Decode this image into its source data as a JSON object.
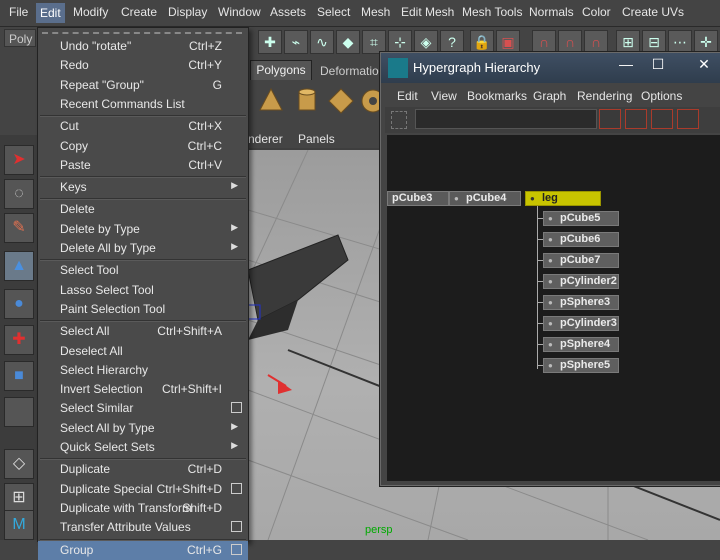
{
  "menubar": {
    "items": [
      "File",
      "Edit",
      "Modify",
      "Create",
      "Display",
      "Window",
      "Assets",
      "Select",
      "Mesh",
      "Edit Mesh",
      "Mesh Tools",
      "Normals",
      "Color",
      "Create UVs"
    ],
    "active": "Edit"
  },
  "mode_selector": "Poly",
  "shelf": {
    "tabs": [
      "Polygons",
      "Deformatio"
    ]
  },
  "viewport": {
    "menu": [
      "nderer",
      "Panels"
    ],
    "camera_label": "persp"
  },
  "edit_menu": {
    "items": [
      {
        "label": "Undo \"rotate\"",
        "shortcut": "Ctrl+Z"
      },
      {
        "label": "Redo",
        "shortcut": "Ctrl+Y"
      },
      {
        "label": "Repeat \"Group\"",
        "shortcut": "G"
      },
      {
        "label": "Recent Commands List",
        "shortcut": ""
      },
      {
        "sep": true
      },
      {
        "label": "Cut",
        "shortcut": "Ctrl+X"
      },
      {
        "label": "Copy",
        "shortcut": "Ctrl+C"
      },
      {
        "label": "Paste",
        "shortcut": "Ctrl+V"
      },
      {
        "sep": true
      },
      {
        "label": "Keys",
        "shortcut": "",
        "submenu": true
      },
      {
        "sep": true
      },
      {
        "label": "Delete",
        "shortcut": ""
      },
      {
        "label": "Delete by Type",
        "shortcut": "",
        "submenu": true
      },
      {
        "label": "Delete All by Type",
        "shortcut": "",
        "submenu": true
      },
      {
        "sep": true
      },
      {
        "label": "Select Tool",
        "shortcut": ""
      },
      {
        "label": "Lasso Select Tool",
        "shortcut": ""
      },
      {
        "label": "Paint Selection Tool",
        "shortcut": ""
      },
      {
        "sep": true
      },
      {
        "label": "Select All",
        "shortcut": "Ctrl+Shift+A"
      },
      {
        "label": "Deselect All",
        "shortcut": ""
      },
      {
        "label": "Select Hierarchy",
        "shortcut": ""
      },
      {
        "label": "Invert Selection",
        "shortcut": "Ctrl+Shift+I"
      },
      {
        "label": "Select Similar",
        "shortcut": "",
        "option": true
      },
      {
        "label": "Select All by Type",
        "shortcut": "",
        "submenu": true
      },
      {
        "label": "Quick Select Sets",
        "shortcut": "",
        "submenu": true
      },
      {
        "sep": true
      },
      {
        "label": "Duplicate",
        "shortcut": "Ctrl+D"
      },
      {
        "label": "Duplicate Special",
        "shortcut": "Ctrl+Shift+D",
        "option": true
      },
      {
        "label": "Duplicate with Transform",
        "shortcut": "Shift+D"
      },
      {
        "label": "Transfer Attribute Values",
        "shortcut": "",
        "option": true
      },
      {
        "sep": true
      },
      {
        "label": "Group",
        "shortcut": "Ctrl+G",
        "option": true,
        "highlighted": true
      }
    ]
  },
  "hypergraph": {
    "title": "Hypergraph Hierarchy",
    "window_buttons": [
      "—",
      "☐",
      "✕"
    ],
    "menu": [
      "Edit",
      "View",
      "Bookmarks",
      "Graph",
      "Rendering",
      "Options"
    ],
    "top_nodes": [
      "pCube3",
      "pCube4",
      "leg"
    ],
    "selected_node": "leg",
    "children": [
      "pCube5",
      "pCube6",
      "pCube7",
      "pCylinder2",
      "pSphere3",
      "pCylinder3",
      "pSphere4",
      "pSphere5"
    ]
  },
  "colors": {
    "selected_node": "#c8c400",
    "menu_highlight": "#5d7ea8",
    "title_bar": "#2f3d4d"
  }
}
